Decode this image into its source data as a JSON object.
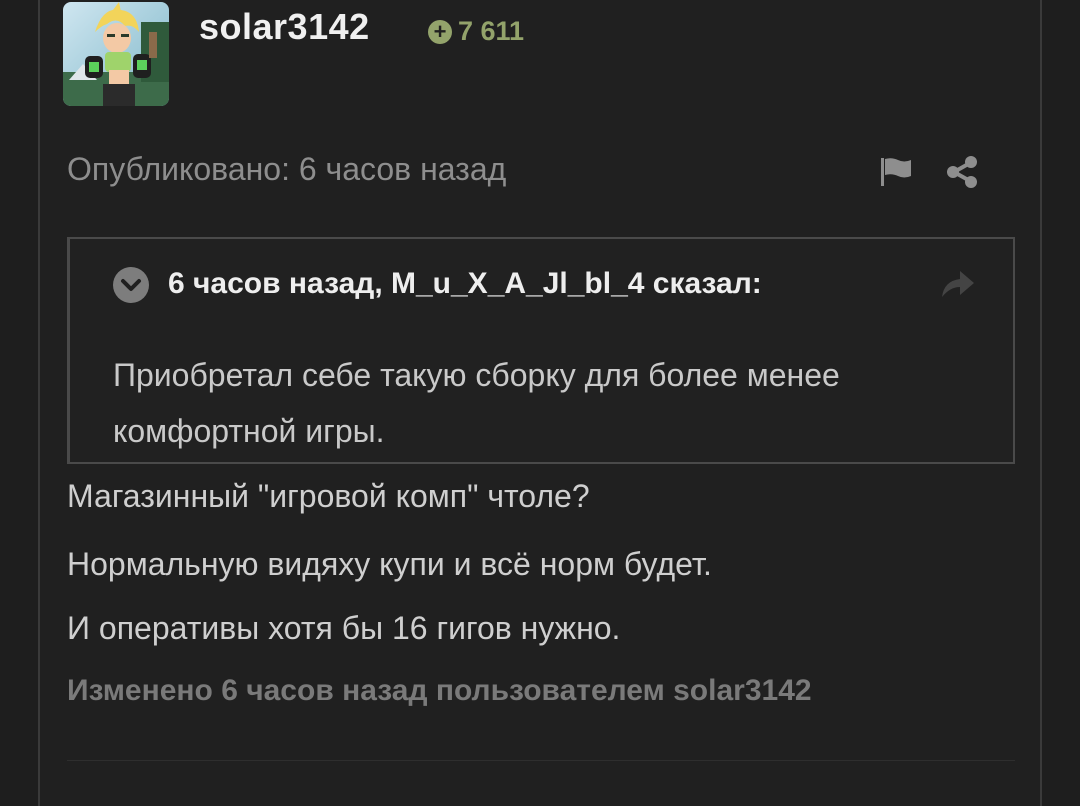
{
  "post": {
    "author": {
      "username": "solar3142",
      "reputation": "7 611",
      "reputation_icon": "plus-circle-icon",
      "accent_color": "#93a36b"
    },
    "posted_label": "Опубликовано: 6 часов назад",
    "actions": {
      "report_icon": "flag-icon",
      "share_icon": "share-icon"
    },
    "quote": {
      "header": "6 часов назад, M_u_X_A_Jl_bl_4 сказал:",
      "text": "Приобретал себе такую сборку для более менее комфортной игры."
    },
    "paragraphs": [
      "Магазинный \"игровой комп\" чтоле?",
      "Нормальную видяху купи и всё норм будет.",
      "И оперативы хотя бы 16 гигов нужно."
    ],
    "edited_label": "Изменено 6 часов назад пользователем solar3142"
  }
}
